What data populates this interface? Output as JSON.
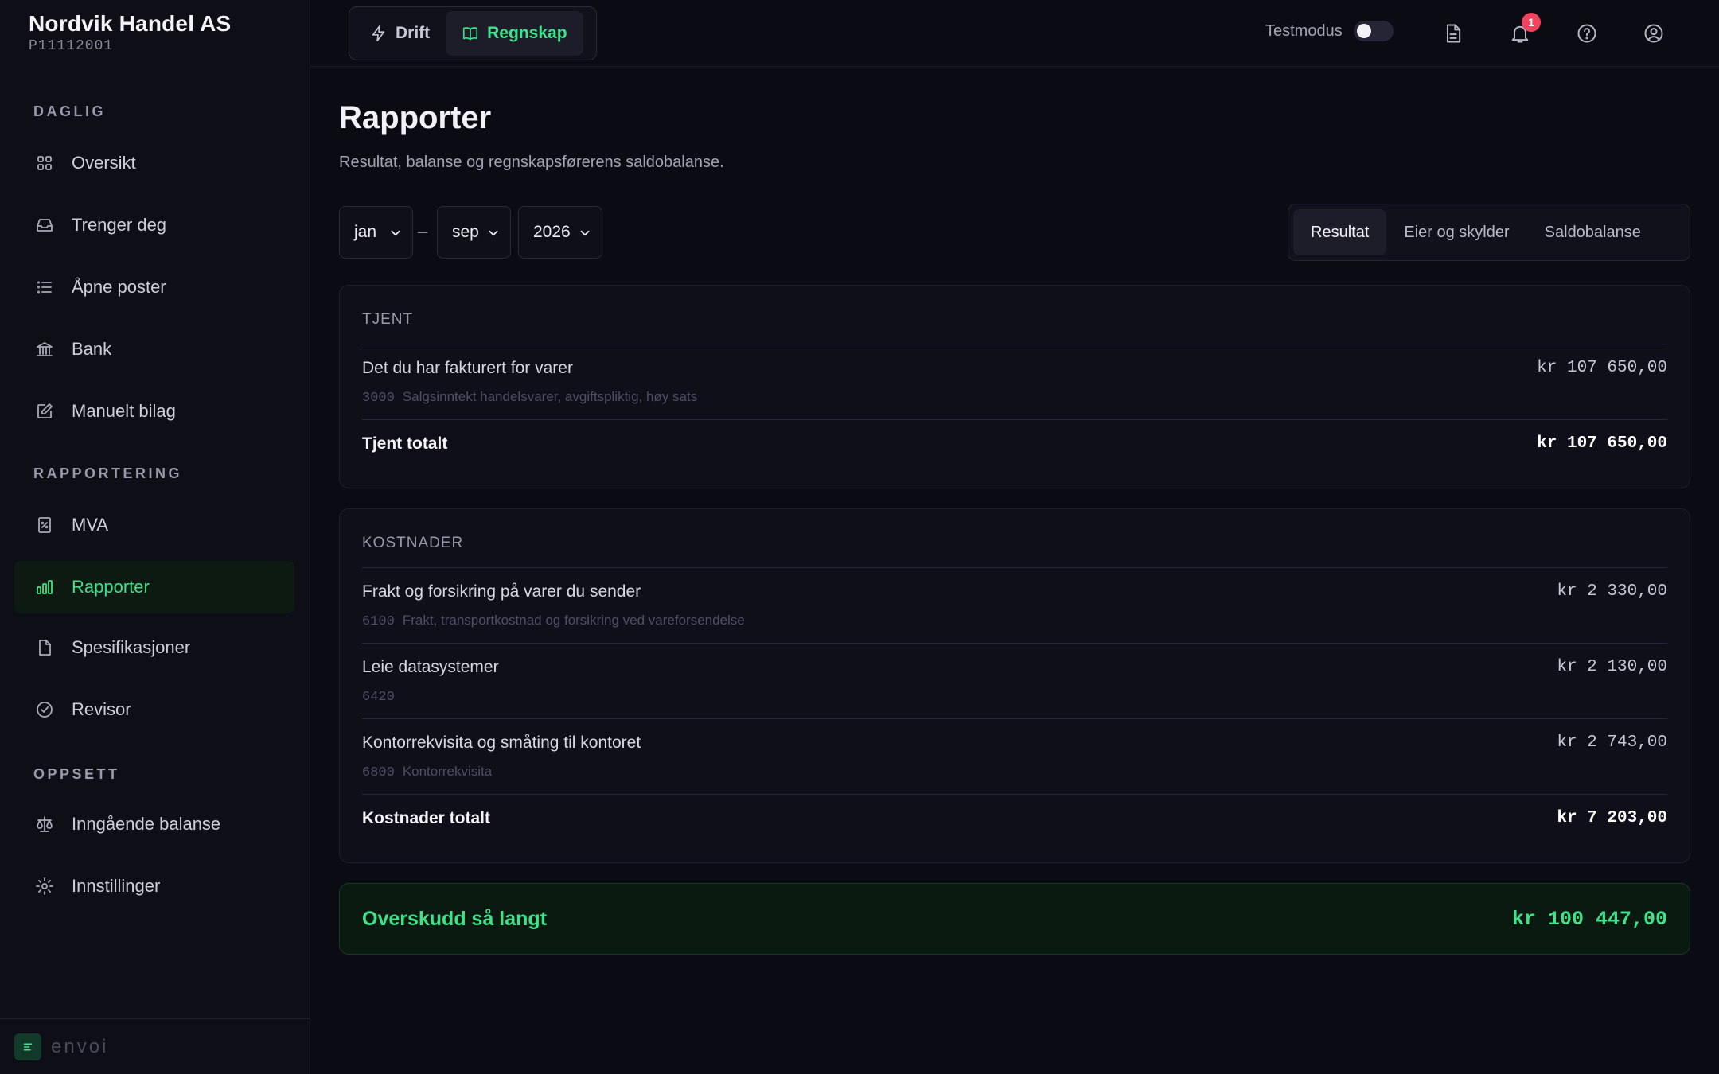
{
  "company": {
    "name": "Nordvik Handel AS",
    "id": "P11112001"
  },
  "sidebar": {
    "sections": [
      {
        "label": "DAGLIG"
      },
      {
        "label": "RAPPORTERING"
      },
      {
        "label": "OPPSETT"
      }
    ],
    "items": [
      {
        "label": "Oversikt",
        "icon": "grid-icon"
      },
      {
        "label": "Trenger deg",
        "icon": "inbox-icon"
      },
      {
        "label": "Åpne poster",
        "icon": "list-icon"
      },
      {
        "label": "Bank",
        "icon": "bank-icon"
      },
      {
        "label": "Manuelt bilag",
        "icon": "edit-icon"
      },
      {
        "label": "MVA",
        "icon": "receipt-percent-icon"
      },
      {
        "label": "Rapporter",
        "icon": "bar-chart-icon",
        "active": true
      },
      {
        "label": "Spesifikasjoner",
        "icon": "file-icon"
      },
      {
        "label": "Revisor",
        "icon": "check-circle-icon"
      },
      {
        "label": "Inngående balanse",
        "icon": "scale-icon"
      },
      {
        "label": "Innstillinger",
        "icon": "gear-icon"
      }
    ],
    "footer_logo": "envoi"
  },
  "topbar": {
    "modes": [
      {
        "label": "Drift",
        "icon": "lightning-icon"
      },
      {
        "label": "Regnskap",
        "icon": "book-icon",
        "active": true
      }
    ],
    "testmode_label": "Testmodus",
    "testmode_on": false,
    "notification_count": "1"
  },
  "main": {
    "title": "Rapporter",
    "subtitle": "Resultat, balanse og regnskapsførerens saldobalanse.",
    "period": {
      "from_month": "jan",
      "to_month": "sep",
      "year": "2026",
      "separator": "–"
    },
    "tabs": [
      {
        "label": "Resultat",
        "active": true
      },
      {
        "label": "Eier og skylder"
      },
      {
        "label": "Saldobalanse"
      }
    ],
    "income": {
      "heading": "TJENT",
      "rows": [
        {
          "title": "Det du har fakturert for varer",
          "account": "3000",
          "account_name": "Salgsinntekt handelsvarer, avgiftspliktig, høy sats",
          "amount": "kr 107 650,00"
        }
      ],
      "total_label": "Tjent totalt",
      "total_amount": "kr 107 650,00"
    },
    "costs": {
      "heading": "KOSTNADER",
      "rows": [
        {
          "title": "Frakt og forsikring på varer du sender",
          "account": "6100",
          "account_name": "Frakt, transportkostnad og forsikring ved vareforsendelse",
          "amount": "kr 2 330,00"
        },
        {
          "title": "Leie datasystemer",
          "account": "6420",
          "account_name": "",
          "amount": "kr 2 130,00"
        },
        {
          "title": "Kontorrekvisita og småting til kontoret",
          "account": "6800",
          "account_name": "Kontorrekvisita",
          "amount": "kr 2 743,00"
        }
      ],
      "total_label": "Kostnader totalt",
      "total_amount": "kr 7 203,00"
    },
    "result": {
      "label": "Overskudd så langt",
      "amount": "kr 100 447,00"
    }
  },
  "colors": {
    "accent": "#3ee28a",
    "badge": "#f0435e",
    "background": "#0b0b13"
  }
}
